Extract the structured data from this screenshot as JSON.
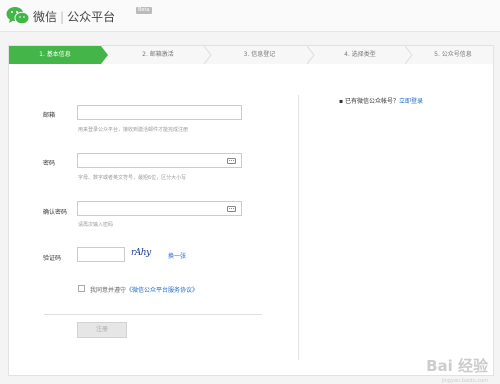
{
  "header": {
    "brand_name": "微信",
    "brand_sep": "|",
    "product": "公众平台",
    "badge": "Beta"
  },
  "steps": [
    {
      "label": "1. 基本信息",
      "active": true
    },
    {
      "label": "2. 邮箱激活",
      "active": false
    },
    {
      "label": "3. 信息登记",
      "active": false
    },
    {
      "label": "4. 选择类型",
      "active": false
    },
    {
      "label": "5. 公众号信息",
      "active": false
    }
  ],
  "form": {
    "email_label": "邮箱",
    "email_value": "",
    "email_hint": "用来登录公众平台，接收到激活邮件才能完成注册",
    "password_label": "密码",
    "password_value": "",
    "password_hint": "字母、数字或者英文符号，最短6位，区分大小写",
    "confirm_label": "确认密码",
    "confirm_value": "",
    "confirm_hint": "请再次输入密码",
    "captcha_label": "验证码",
    "captcha_value": "",
    "captcha_image_text": "rAhy",
    "captcha_refresh": "换一张",
    "agree_prefix": "我同意并遵守",
    "agree_link": "《微信公众平台服务协议》",
    "submit_label": "注册"
  },
  "sidebar": {
    "existing_prefix": "已有微信公众帐号？",
    "login_link": "立即登录"
  },
  "watermark": {
    "text": "Bai 经验",
    "sub": "jingyan.baidu.com"
  },
  "colors": {
    "accent": "#44b549",
    "link": "#1e6cc6"
  }
}
